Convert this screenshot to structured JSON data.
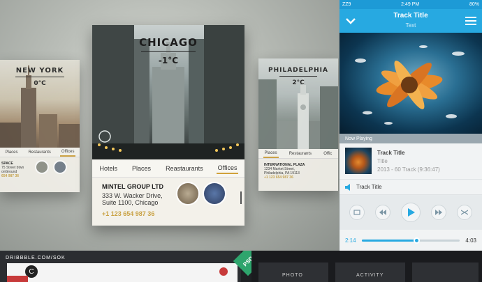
{
  "cities": {
    "new_york": {
      "name": "NEW YORK",
      "temp": "0°C",
      "tabs": [
        "Places",
        "Restaurants",
        "Offices"
      ],
      "active_tab": "Offices",
      "company": "SPACE",
      "address1": "75 Street btwn",
      "address2": "onGround",
      "phone": "654 987 36"
    },
    "chicago": {
      "name": "CHICAGO",
      "temp": "-1°C",
      "tabs": [
        "Hotels",
        "Places",
        "Reastaurants",
        "Offices"
      ],
      "active_tab": "Offices",
      "company": "MINTEL GROUP LTD",
      "address1": "333 W. Wacker Drive,",
      "address2": "Suite 1100, Chicago",
      "phone": "+1 123 654 987 36"
    },
    "philadelphia": {
      "name": "PHILADELPHIA",
      "temp": "2°C",
      "tabs": [
        "Places",
        "Restaurants",
        "Offic"
      ],
      "active_tab": "Places",
      "company": "INTERNATIONAL PLAZA",
      "address1": "1234 Market Street,",
      "address2": "Philadelphia, PA 19113",
      "phone": "+1 123 654 987 36"
    }
  },
  "player": {
    "status": {
      "carrier": "ZZ9",
      "time": "2:49 PM",
      "battery": "80%"
    },
    "header_title": "Track Title",
    "header_sub": "Text",
    "now_playing_label": "Now Playing",
    "track": {
      "title": "Track Title",
      "subtitle": "Title",
      "meta": "2013 - 60 Track (9:36:47)"
    },
    "current_track": "Track Title",
    "elapsed": "2:14",
    "remaining": "4:03",
    "progress": 0.56,
    "accent": "#27a9e1"
  },
  "bottom": {
    "dribbble": "DRIBBBLE.COM/SOK",
    "psd": "PSD",
    "label_photo": "PHOTO",
    "label_activity": "ACTIVITY"
  }
}
